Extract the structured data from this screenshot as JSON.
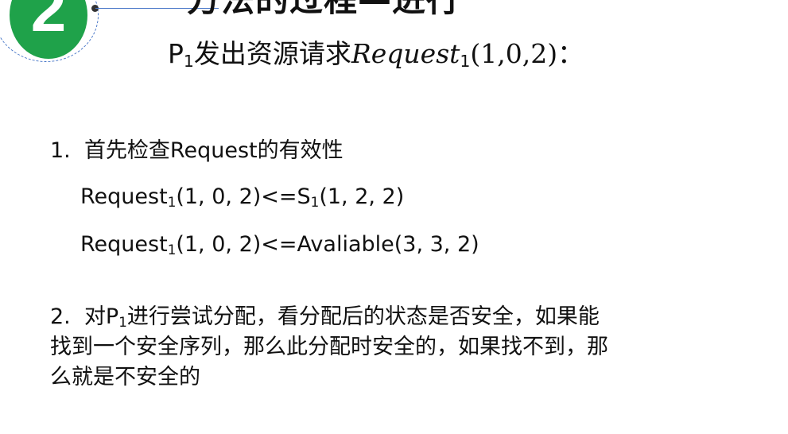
{
  "badge": {
    "number": "2",
    "clipped_title": "方法的过程—进行"
  },
  "heading": {
    "prefix": "P",
    "prefix_sub": "1",
    "text": "发出资源请求",
    "math_name": "Request",
    "math_sub": "1",
    "math_args": "(1,0,2)",
    "colon": "："
  },
  "item1": {
    "number": "1.",
    "text": "首先检查Request的有效性"
  },
  "check1": {
    "name": "Request",
    "sub": "1",
    "args": "(1, 0, 2)",
    "op": "<=",
    "rhs_name": "S",
    "rhs_sub": "1",
    "rhs_args": "(1, 2, 2)"
  },
  "check2": {
    "name": "Request",
    "sub": "1",
    "args": "(1, 0, 2)",
    "op": "<=",
    "rhs": "Avaliable(3, 3, 2)"
  },
  "item2": {
    "number": "2.",
    "pre": "对P",
    "sub": "1",
    "line1_rest": "进行尝试分配，看分配后的状态是否安全，如果能",
    "line2": "找到一个安全序列，那么此分配时安全的，如果找不到，那",
    "line3": "么就是不安全的"
  }
}
